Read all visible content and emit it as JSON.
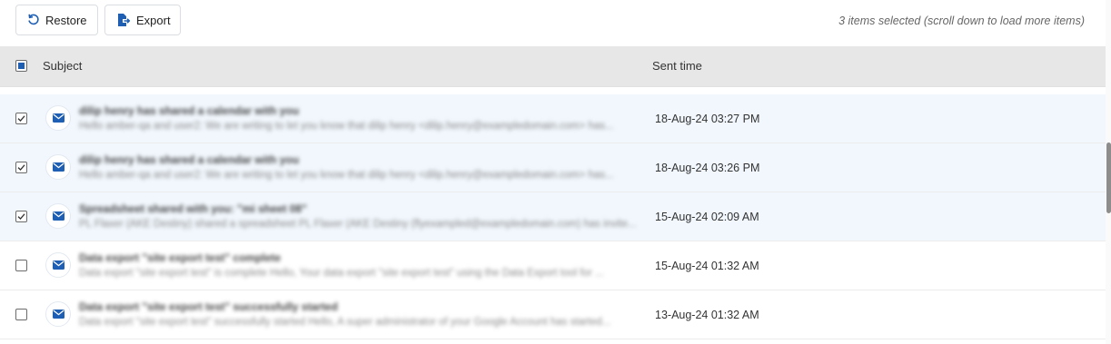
{
  "toolbar": {
    "restore_label": "Restore",
    "export_label": "Export",
    "selection_info": "3 items selected (scroll down to load more items)"
  },
  "table": {
    "columns": {
      "subject": "Subject",
      "sent_time": "Sent time"
    },
    "rows": [
      {
        "selected": true,
        "subject": "dilip henry has shared a calendar with you",
        "preview": "Hello amber-qa and user2: We are writing to let you know that dilip henry <dilip.henry@exampledomain.com> has...",
        "sent_time": "18-Aug-24 03:27 PM"
      },
      {
        "selected": true,
        "subject": "dilip henry has shared a calendar with you",
        "preview": "Hello amber-qa and user2: We are writing to let you know that dilip henry <dilip.henry@exampledomain.com> has...",
        "sent_time": "18-Aug-24 03:26 PM"
      },
      {
        "selected": true,
        "subject": "Spreadsheet shared with you: \"mi sheet 08\"",
        "preview": "PL Flaxer (AKE Destiny) shared a spreadsheet PL Flaxer (AKE Destiny (flyexampled@exampledomain.com) has invite...",
        "sent_time": "15-Aug-24 02:09 AM"
      },
      {
        "selected": false,
        "subject": "Data export \"site export test\" complete",
        "preview": "Data export \"site export test\" is complete Hello, Your data export \"site export test\" using the Data Export tool for ...",
        "sent_time": "15-Aug-24 01:32 AM"
      },
      {
        "selected": false,
        "subject": "Data export \"site export test\" successfully started",
        "preview": "Data export \"site export test\" successfully started Hello, A super administrator of your Google Account has started...",
        "sent_time": "13-Aug-24 01:32 AM"
      }
    ]
  },
  "colors": {
    "accent": "#1e5fb3",
    "selected_row": "#f1f7fd",
    "header_bg": "#e7e7e7"
  },
  "icons": {
    "restore": "restore-icon",
    "export": "export-icon",
    "mail": "mail-icon"
  }
}
